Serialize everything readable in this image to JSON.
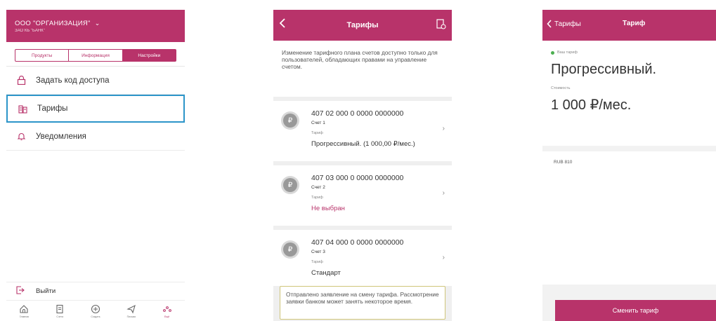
{
  "screen1": {
    "org_name": "ООО \"ОРГАНИЗАЦИЯ\"",
    "org_sub": "ЗАО КБ \"БАНК\"",
    "segments": [
      "Продукты",
      "Информация",
      "Настройки"
    ],
    "menu": [
      {
        "label": "Задать код доступа",
        "icon": "lock-icon"
      },
      {
        "label": "Тарифы",
        "icon": "tariffs-icon"
      },
      {
        "label": "Уведомления",
        "icon": "bell-icon"
      }
    ],
    "logout_label": "Выйти",
    "tabs": [
      "Главная",
      "Счета",
      "Создать",
      "Письма",
      "Ещё"
    ]
  },
  "screen2": {
    "title": "Тарифы",
    "notice": "Изменение тарифного плана счетов доступно только для пользователей, обладающих правами на управление счетом.",
    "accounts": [
      {
        "number": "407 02 000 0 0000 0000000",
        "name": "Счет 1",
        "tariff_label": "Тариф",
        "tariff_value": "Прогрессивный. (1 000,00 ₽/мес.)",
        "highlight": false
      },
      {
        "number": "407 03 000 0 0000 0000000",
        "name": "Счет 2",
        "tariff_label": "Тариф",
        "tariff_value": "Не выбран",
        "highlight": true
      },
      {
        "number": "407 04 000 0 0000 0000000",
        "name": "Счет 3",
        "tariff_label": "Тариф",
        "tariff_value": "Стандарт",
        "highlight": false
      }
    ],
    "pending": "Отправлено заявление на смену тарифа. Рассмотрение заявки банком может занять некоторое время."
  },
  "screen3": {
    "back_label": "Тарифы",
    "title": "Тариф",
    "current_label": "Ваш тариф",
    "tariff_name": "Прогрессивный.",
    "cost_label": "Стоимость",
    "cost_value": "1 000 ₽/мес.",
    "currency": "RUB 810",
    "change_button": "Сменить тариф"
  },
  "colors": {
    "accent": "#b8336a",
    "selection": "#2c95c9",
    "status_ok": "#4caf50"
  }
}
